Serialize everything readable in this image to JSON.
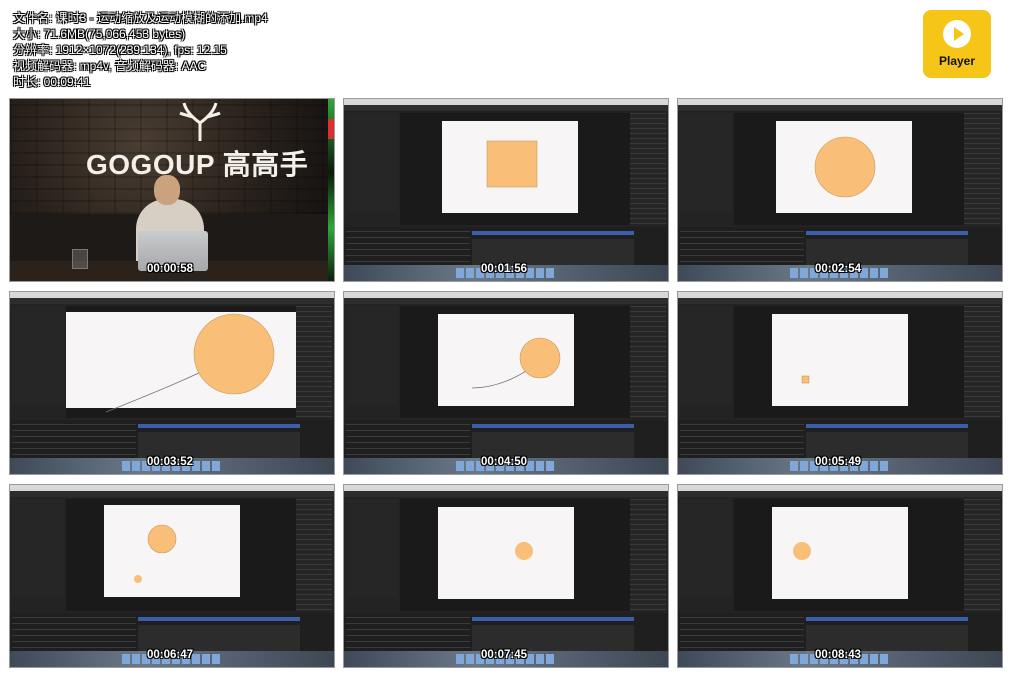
{
  "file_info": {
    "filename": "文件名: 课时3 - 运动缩放及运动模糊的添加.mp4",
    "size": "大小: 71.6MB(75,066,453 bytes)",
    "resolution": "分辨率: 1912×1072(239:134), fps: 12.15",
    "codecs": "视频解码器: mp4v, 音频解码器: AAC",
    "duration": "时长: 00:09:41"
  },
  "player_logo": {
    "label": "Player",
    "icon": "play-icon",
    "color": "#f5c518"
  },
  "video_frame": {
    "brand_text": "GOGOUP 高高手"
  },
  "colors": {
    "shape_orange": "#f9bf78",
    "canvas": "#f8f5f7",
    "timeline_accent": "#3b5fa8"
  },
  "thumbnails": [
    {
      "timestamp": "00:00:58",
      "kind": "video"
    },
    {
      "timestamp": "00:01:56",
      "kind": "ae",
      "shape": "square"
    },
    {
      "timestamp": "00:02:54",
      "kind": "ae",
      "shape": "circle"
    },
    {
      "timestamp": "00:03:52",
      "kind": "ae",
      "shape": "circle-large-path"
    },
    {
      "timestamp": "00:04:50",
      "kind": "ae",
      "shape": "circle-path"
    },
    {
      "timestamp": "00:05:49",
      "kind": "ae",
      "shape": "tiny-square"
    },
    {
      "timestamp": "00:06:47",
      "kind": "ae",
      "shape": "two-circles"
    },
    {
      "timestamp": "00:07:45",
      "kind": "ae",
      "shape": "circle-small"
    },
    {
      "timestamp": "00:08:43",
      "kind": "ae",
      "shape": "circle-small-left"
    }
  ]
}
